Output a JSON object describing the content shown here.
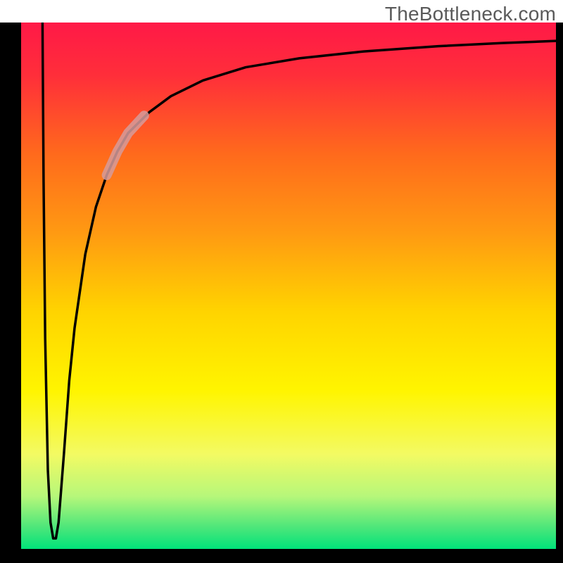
{
  "watermark": "TheBottleneck.com",
  "chart_data": {
    "type": "line",
    "title": "",
    "xlabel": "",
    "ylabel": "",
    "xlim": [
      0,
      100
    ],
    "ylim": [
      0,
      100
    ],
    "grid": false,
    "legend": false,
    "background_gradient": {
      "stops": [
        {
          "offset": 0.0,
          "color": "#ff1947"
        },
        {
          "offset": 0.1,
          "color": "#ff2e3a"
        },
        {
          "offset": 0.25,
          "color": "#ff6a1c"
        },
        {
          "offset": 0.4,
          "color": "#ff9a12"
        },
        {
          "offset": 0.55,
          "color": "#ffd400"
        },
        {
          "offset": 0.7,
          "color": "#fff500"
        },
        {
          "offset": 0.82,
          "color": "#f3fa63"
        },
        {
          "offset": 0.9,
          "color": "#b6f77a"
        },
        {
          "offset": 0.96,
          "color": "#4be67a"
        },
        {
          "offset": 1.0,
          "color": "#00e37a"
        }
      ]
    },
    "frame_color": "#000000",
    "series": [
      {
        "name": "bottleneck-curve",
        "color": "#000000",
        "stroke_width": 3.5,
        "points": [
          {
            "x": 4.0,
            "y": 100.0
          },
          {
            "x": 4.2,
            "y": 70.0
          },
          {
            "x": 4.5,
            "y": 40.0
          },
          {
            "x": 5.0,
            "y": 15.0
          },
          {
            "x": 5.5,
            "y": 5.0
          },
          {
            "x": 6.0,
            "y": 2.0
          },
          {
            "x": 6.5,
            "y": 2.0
          },
          {
            "x": 7.0,
            "y": 5.0
          },
          {
            "x": 8.0,
            "y": 18.0
          },
          {
            "x": 9.0,
            "y": 32.0
          },
          {
            "x": 10.0,
            "y": 42.0
          },
          {
            "x": 12.0,
            "y": 56.0
          },
          {
            "x": 14.0,
            "y": 65.0
          },
          {
            "x": 16.0,
            "y": 71.0
          },
          {
            "x": 18.0,
            "y": 75.5
          },
          {
            "x": 20.0,
            "y": 79.0
          },
          {
            "x": 24.0,
            "y": 83.0
          },
          {
            "x": 28.0,
            "y": 86.0
          },
          {
            "x": 34.0,
            "y": 89.0
          },
          {
            "x": 42.0,
            "y": 91.5
          },
          {
            "x": 52.0,
            "y": 93.2
          },
          {
            "x": 64.0,
            "y": 94.5
          },
          {
            "x": 78.0,
            "y": 95.5
          },
          {
            "x": 90.0,
            "y": 96.1
          },
          {
            "x": 100.0,
            "y": 96.5
          }
        ]
      },
      {
        "name": "highlight-segment",
        "color": "#d69b9b",
        "stroke_width": 14,
        "opacity": 0.85,
        "points": [
          {
            "x": 16.0,
            "y": 71.0
          },
          {
            "x": 18.0,
            "y": 75.5
          },
          {
            "x": 20.0,
            "y": 79.0
          },
          {
            "x": 23.0,
            "y": 82.3
          }
        ]
      }
    ]
  }
}
